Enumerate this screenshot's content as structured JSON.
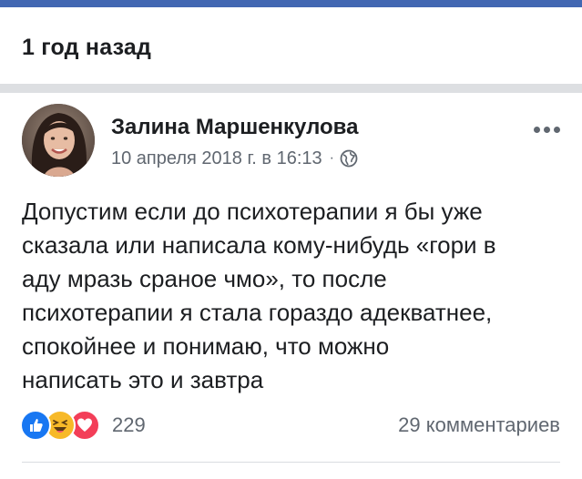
{
  "memory": {
    "title": "1 год назад"
  },
  "post": {
    "author": "Залина Маршенкулова",
    "date": "10 апреля 2018 г. в 16:13",
    "separator": "·",
    "privacy_icon": "globe-icon",
    "more_icon": "more-horizontal-icon",
    "text": "Допустим если до психотерапии я бы уже\nсказала или написала кому-нибудь «гори в\nаду мразь сраное чмо», то после\nпсихотерапии я стала гораздо адекватнее,\nспокойнее  и понимаю, что можно\nнаписать это и завтра",
    "reactions": {
      "icons": [
        "like-icon",
        "haha-icon",
        "love-icon"
      ],
      "count": "229"
    },
    "comments": "29 комментариев"
  },
  "colors": {
    "brand": "#4267b2",
    "like": "#1877f2",
    "haha": "#f7b928",
    "love": "#f33e58",
    "text_primary": "#1c1e21",
    "text_secondary": "#606770"
  }
}
